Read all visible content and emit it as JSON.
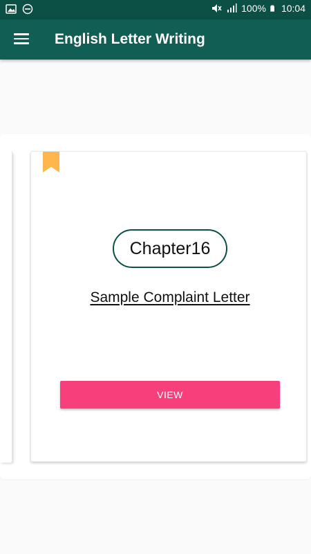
{
  "status_bar": {
    "battery_percent": "100%",
    "time": "10:04",
    "icons": [
      "image-icon",
      "do-not-disturb-icon",
      "mute-icon",
      "signal-icon",
      "battery-icon"
    ]
  },
  "app_bar": {
    "title": "English Letter Writing",
    "menu_icon": "menu-icon"
  },
  "card": {
    "chapter": "Chapter16",
    "title": "Sample Complaint Letter",
    "view_label": "VIEW",
    "bookmark_icon": "bookmark-icon"
  },
  "colors": {
    "status_bar": "#0b4f45",
    "app_bar": "#105e54",
    "bookmark": "#ffb74d",
    "view_button": "#f73f7c",
    "pill_border": "#0b4f45"
  }
}
